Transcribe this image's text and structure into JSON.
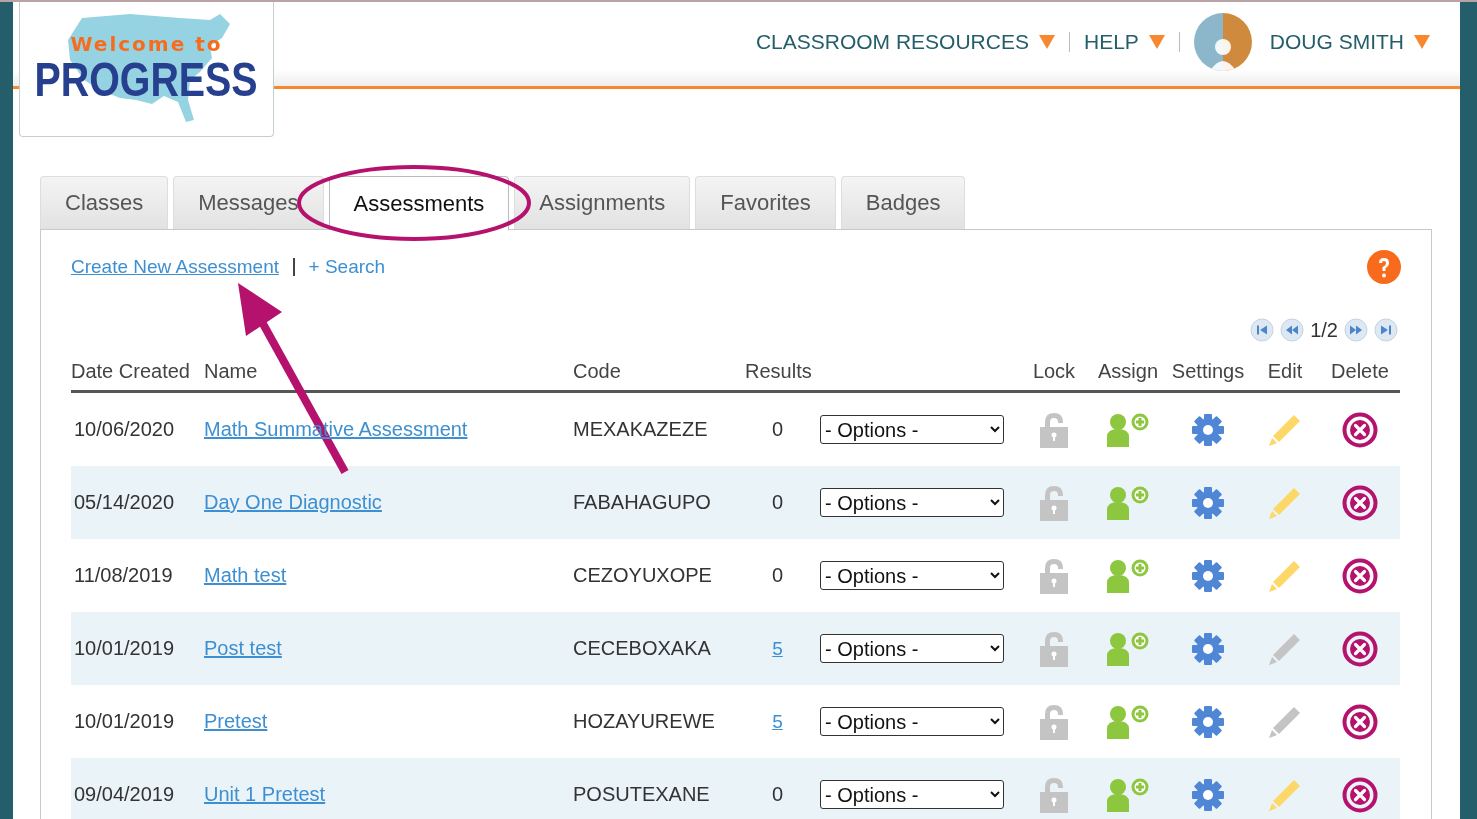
{
  "header": {
    "logo": {
      "tagline": "Welcome to",
      "title": "PROGRESS"
    },
    "nav": [
      {
        "label": "CLASSROOM RESOURCES",
        "kind": "menu"
      },
      {
        "label": "HELP",
        "kind": "menu"
      },
      {
        "label": "DOUG SMITH",
        "kind": "user"
      }
    ]
  },
  "tabs": [
    {
      "label": "Classes",
      "selected": false
    },
    {
      "label": "Messages",
      "selected": false
    },
    {
      "label": "Assessments",
      "selected": true
    },
    {
      "label": "Assignments",
      "selected": false
    },
    {
      "label": "Favorites",
      "selected": false
    },
    {
      "label": "Badges",
      "selected": false
    }
  ],
  "actions": [
    "Create New Assessment",
    "+ Search"
  ],
  "pagination": {
    "page": "1/2"
  },
  "table": {
    "columns": [
      {
        "label": "Date Created",
        "kind": "date"
      },
      {
        "label": "Name",
        "kind": "name"
      },
      {
        "label": "Code",
        "kind": "code"
      },
      {
        "label": "Results",
        "kind": "results"
      },
      {
        "label": "Lock",
        "kind": "lock"
      },
      {
        "label": "Assign",
        "kind": "assign"
      },
      {
        "label": "Settings",
        "kind": "settings"
      },
      {
        "label": "Edit",
        "kind": "edit"
      },
      {
        "label": "Delete",
        "kind": "delete"
      }
    ],
    "rows": [
      {
        "date": "10/06/2020",
        "name": "Math Summative Assessment",
        "code": "MEXAKAZEZE",
        "results": "0",
        "results_linked": false,
        "options": "- Options -",
        "editable": true
      },
      {
        "date": "05/14/2020",
        "name": "Day One Diagnostic",
        "code": "FABAHAGUPO",
        "results": "0",
        "results_linked": false,
        "options": "- Options -",
        "editable": true
      },
      {
        "date": "11/08/2019",
        "name": "Math test",
        "code": "CEZOYUXOPE",
        "results": "0",
        "results_linked": false,
        "options": "- Options -",
        "editable": true
      },
      {
        "date": "10/01/2019",
        "name": "Post test",
        "code": "CECEBOXAKA",
        "results": "5",
        "results_linked": true,
        "options": "- Options -",
        "editable": false
      },
      {
        "date": "10/01/2019",
        "name": "Pretest",
        "code": "HOZAYUREWE",
        "results": "5",
        "results_linked": true,
        "options": "- Options -",
        "editable": false
      },
      {
        "date": "09/04/2019",
        "name": "Unit 1 Pretest",
        "code": "POSUTEXANE",
        "results": "0",
        "results_linked": false,
        "options": "- Options -",
        "editable": true
      }
    ]
  }
}
